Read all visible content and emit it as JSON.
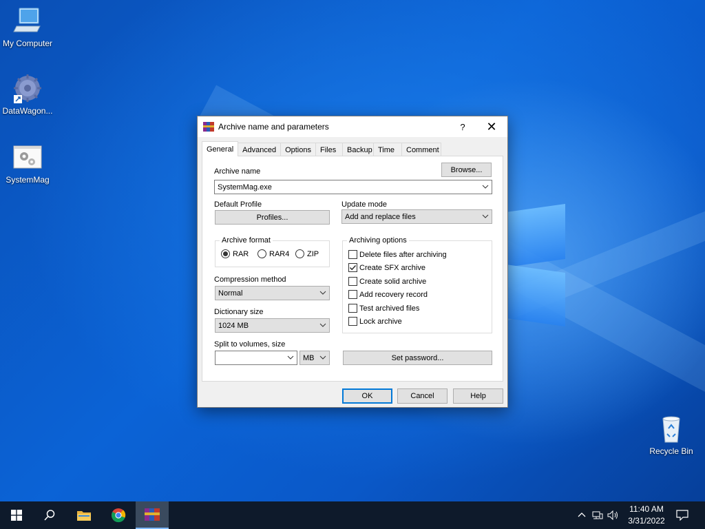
{
  "desktop": {
    "icons": [
      {
        "label": "My Computer"
      },
      {
        "label": "DataWagon..."
      },
      {
        "label": "SystemMag"
      },
      {
        "label": "Recycle Bin"
      }
    ]
  },
  "dialog": {
    "title": "Archive name and parameters",
    "help_glyph": "?",
    "close_glyph": "✕",
    "tabs": [
      "General",
      "Advanced",
      "Options",
      "Files",
      "Backup",
      "Time",
      "Comment"
    ],
    "active_tab": "General",
    "archive_name_label": "Archive name",
    "browse_label": "Browse...",
    "archive_name_value": "SystemMag.exe",
    "default_profile_label": "Default Profile",
    "profiles_label": "Profiles...",
    "update_mode_label": "Update mode",
    "update_mode_value": "Add and replace files",
    "archive_format": {
      "title": "Archive format",
      "options": [
        "RAR",
        "RAR4",
        "ZIP"
      ],
      "selected": "RAR"
    },
    "compression_method_label": "Compression method",
    "compression_method_value": "Normal",
    "dictionary_size_label": "Dictionary size",
    "dictionary_size_value": "1024 MB",
    "split_label": "Split to volumes, size",
    "split_value": "",
    "split_unit": "MB",
    "archiving_options": {
      "title": "Archiving options",
      "items": [
        {
          "label": "Delete files after archiving",
          "checked": false
        },
        {
          "label": "Create SFX archive",
          "checked": true
        },
        {
          "label": "Create solid archive",
          "checked": false
        },
        {
          "label": "Add recovery record",
          "checked": false
        },
        {
          "label": "Test archived files",
          "checked": false
        },
        {
          "label": "Lock archive",
          "checked": false
        }
      ]
    },
    "set_password_label": "Set password...",
    "ok_label": "OK",
    "cancel_label": "Cancel",
    "help_label": "Help"
  },
  "taskbar": {
    "time": "11:40 AM",
    "date": "3/31/2022",
    "items": [
      "start-icon",
      "search-icon",
      "file-explorer-icon",
      "chrome-icon",
      "winrar-icon"
    ]
  },
  "colors": {
    "accent": "#0078d7",
    "taskbar": "#0e1a2b",
    "desktop": "#0b63d6"
  }
}
